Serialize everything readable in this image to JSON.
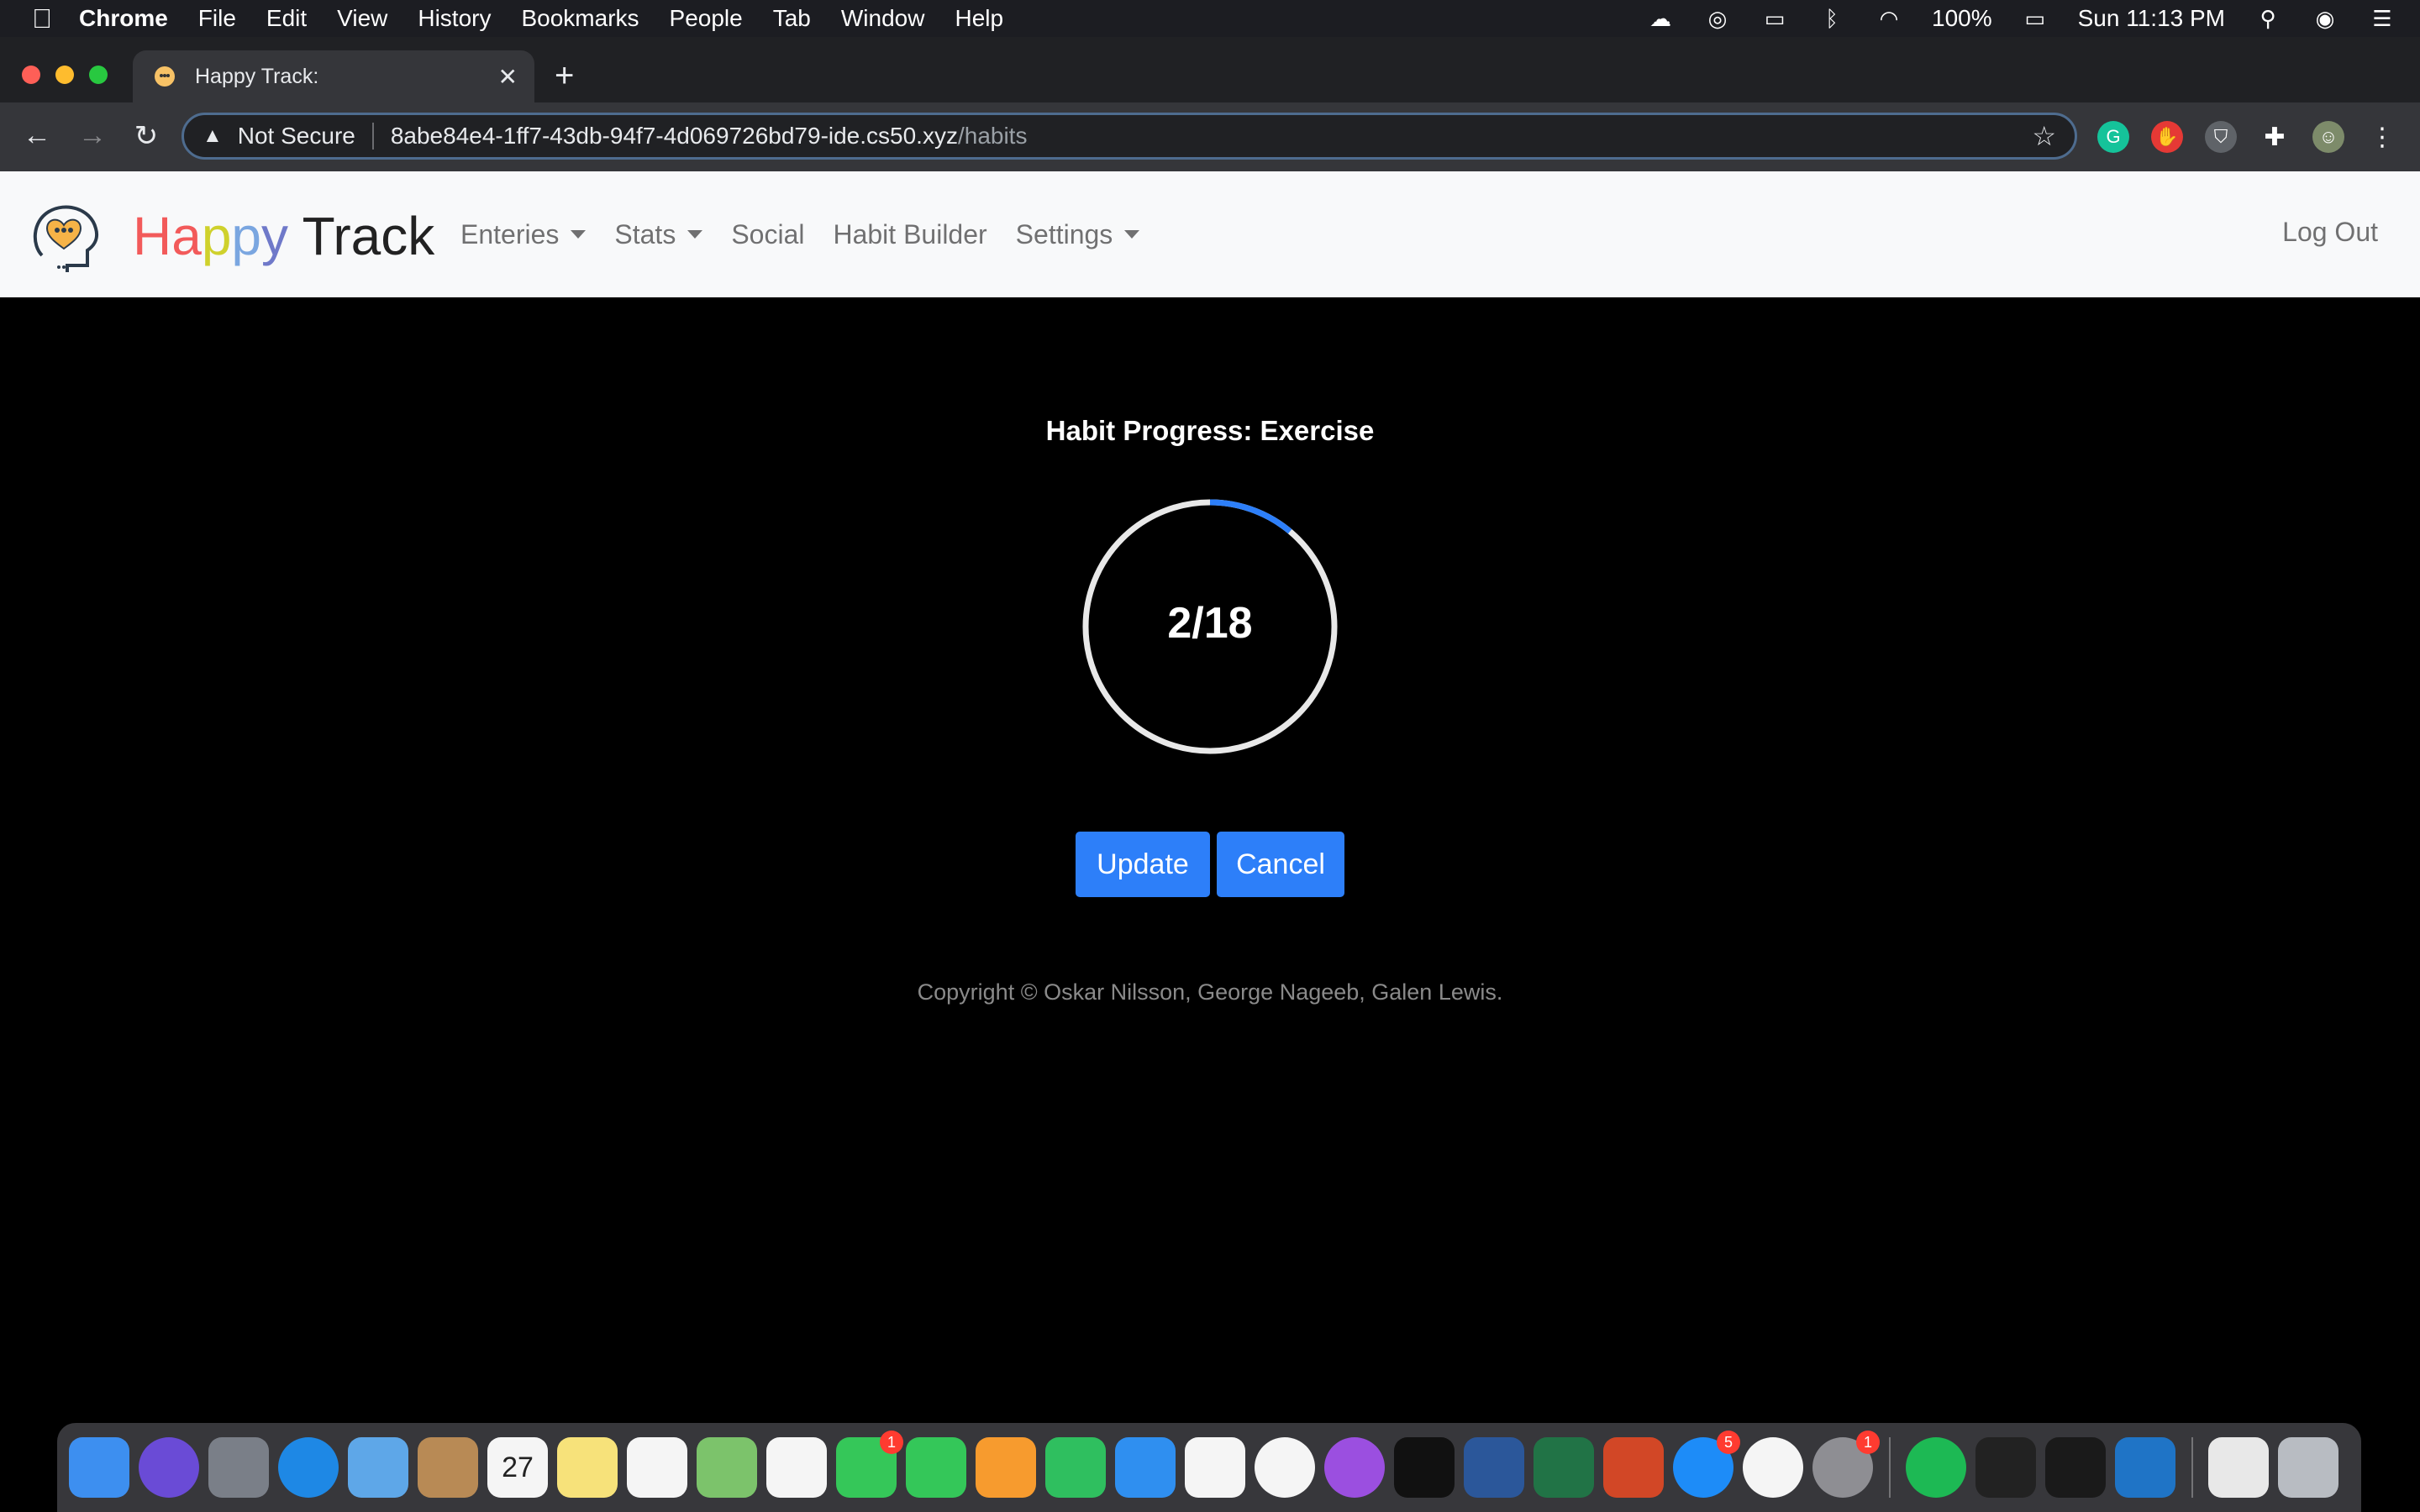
{
  "menubar": {
    "app": "Chrome",
    "items": [
      "File",
      "Edit",
      "View",
      "History",
      "Bookmarks",
      "People",
      "Tab",
      "Window",
      "Help"
    ],
    "battery": "100%",
    "clock": "Sun 11:13 PM"
  },
  "browser": {
    "tab_title": "Happy Track:",
    "security_label": "Not Secure",
    "url_host": "8abe84e4-1ff7-43db-94f7-4d069726bd79-ide.cs50.xyz",
    "url_path": "/habits"
  },
  "site": {
    "brand_letters": [
      "Ha",
      "p",
      "p",
      "y"
    ],
    "brand_track": "Track",
    "nav": {
      "enteries": "Enteries",
      "stats": "Stats",
      "social": "Social",
      "habit_builder": "Habit Builder",
      "settings": "Settings",
      "logout": "Log Out"
    }
  },
  "habit": {
    "heading": "Habit Progress: Exercise",
    "progress_label": "2/18",
    "completed": 2,
    "goal": 18,
    "ring_color": "#2d7ff9",
    "track_color": "#e8e8e8"
  },
  "actions": {
    "update": "Update",
    "cancel": "Cancel"
  },
  "footer": {
    "copyright": "Copyright © Oskar Nilsson, George Nageeb, Galen Lewis."
  },
  "dock": {
    "apps": [
      "finder",
      "siri",
      "launchpad",
      "safari",
      "mail",
      "contacts",
      "calendar",
      "notes",
      "reminders",
      "maps",
      "photos",
      "messages",
      "facetime",
      "pages",
      "numbers",
      "keynote",
      "news",
      "music",
      "podcasts",
      "apple-tv",
      "word",
      "excel",
      "powerpoint",
      "app-store",
      "chrome",
      "system-preferences",
      "spotify",
      "terminal",
      "acrobat",
      "vscode",
      "archive",
      "trash"
    ],
    "calendar_day": "27",
    "badges": {
      "messages": "1",
      "app-store": "5",
      "system-preferences": "1"
    }
  }
}
